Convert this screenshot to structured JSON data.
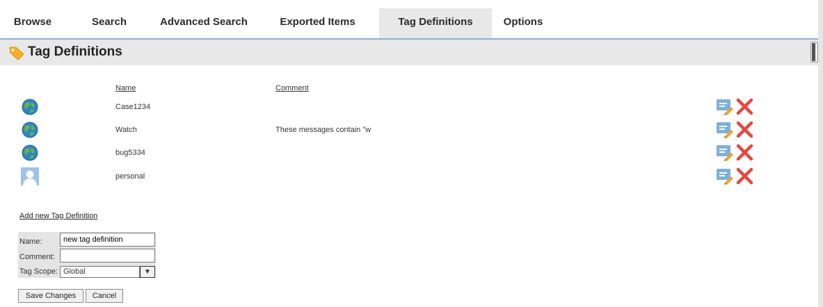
{
  "tabs": [
    {
      "label": "Browse"
    },
    {
      "label": "Search"
    },
    {
      "label": "Advanced Search"
    },
    {
      "label": "Exported Items"
    },
    {
      "label": "Tag Definitions",
      "active": true
    },
    {
      "label": "Options"
    }
  ],
  "page": {
    "title": "Tag Definitions",
    "icon": "tag-icon"
  },
  "table": {
    "headers": {
      "name": "Name",
      "comment": "Comment"
    },
    "rows": [
      {
        "icon": "globe-icon",
        "name": "Case1234",
        "comment": ""
      },
      {
        "icon": "globe-icon",
        "name": "Watch",
        "comment": "These messages contain \"w"
      },
      {
        "icon": "globe-icon",
        "name": "bug5334",
        "comment": ""
      },
      {
        "icon": "person-icon",
        "name": "personal",
        "comment": ""
      }
    ]
  },
  "add_form": {
    "link_label": "Add new Tag Definition",
    "name_label": "Name:",
    "name_value": "new tag definition",
    "comment_label": "Comment:",
    "comment_value": "",
    "scope_label": "Tag Scope:",
    "scope_value": "Global"
  },
  "buttons": {
    "save_label": "Save Changes",
    "cancel_label": "Cancel"
  },
  "colors": {
    "accent_line": "#8eaed4",
    "active_tab_bg": "#e8e8e8",
    "delete_red": "#e8463c",
    "edit_blue": "#7fb0d8",
    "tag_orange": "#f5b027"
  }
}
